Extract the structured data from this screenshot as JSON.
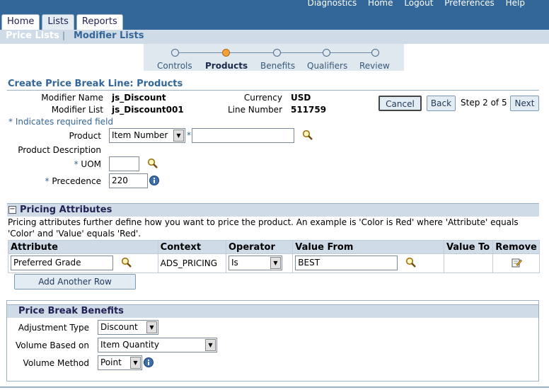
{
  "global_links": [
    "Diagnostics",
    "Home",
    "Logout",
    "Preferences",
    "Help"
  ],
  "tabs": [
    {
      "label": "Home"
    },
    {
      "label": "Lists"
    },
    {
      "label": "Reports"
    }
  ],
  "subtabs": [
    {
      "label": "Price Lists"
    },
    {
      "label": "Modifier Lists"
    }
  ],
  "train": {
    "steps": [
      "Controls",
      "Products",
      "Benefits",
      "Qualifiers",
      "Review"
    ],
    "active_step": "Products"
  },
  "page_title": "Create Price Break Line: Products",
  "header": {
    "modifier_name_label": "Modifier Name",
    "modifier_name": "js_Discount",
    "modifier_list_label": "Modifier List",
    "modifier_list": "js_Discount001",
    "currency_label": "Currency",
    "currency": "USD",
    "line_number_label": "Line Number",
    "line_number": "511759"
  },
  "nav": {
    "cancel_label": "Cancel",
    "back_label": "Back",
    "step_text": "Step 2 of 5",
    "next_label": "Next"
  },
  "required_note": "Indicates required field",
  "form": {
    "product_label": "Product",
    "product_type": "Item Number",
    "product_value": "",
    "product_description_label": "Product Description",
    "uom_label": "UOM",
    "uom_value": "",
    "precedence_label": "Precedence",
    "precedence_value": "220"
  },
  "pricing_attributes": {
    "title": "Pricing Attributes",
    "description": "Pricing attributes further define how you want to price the product. An example is 'Color is Red' where 'Attribute' equals 'Color' and 'Value' equals 'Red'.",
    "columns": [
      "Attribute",
      "Context",
      "Operator",
      "Value From",
      "Value To",
      "Remove"
    ],
    "rows": [
      {
        "attribute": "Preferred Grade",
        "context": "ADS_PRICING",
        "operator": "Is",
        "value_from": "BEST",
        "value_to": ""
      }
    ],
    "add_row_label": "Add Another Row"
  },
  "price_break_benefits": {
    "title": "Price Break Benefits",
    "adjustment_type_label": "Adjustment Type",
    "adjustment_type": "Discount",
    "volume_based_on_label": "Volume Based on",
    "volume_based_on": "Item Quantity",
    "volume_method_label": "Volume Method",
    "volume_method": "Point"
  },
  "colors": {
    "brand": "#336699",
    "train_active": "#f5a23c"
  }
}
